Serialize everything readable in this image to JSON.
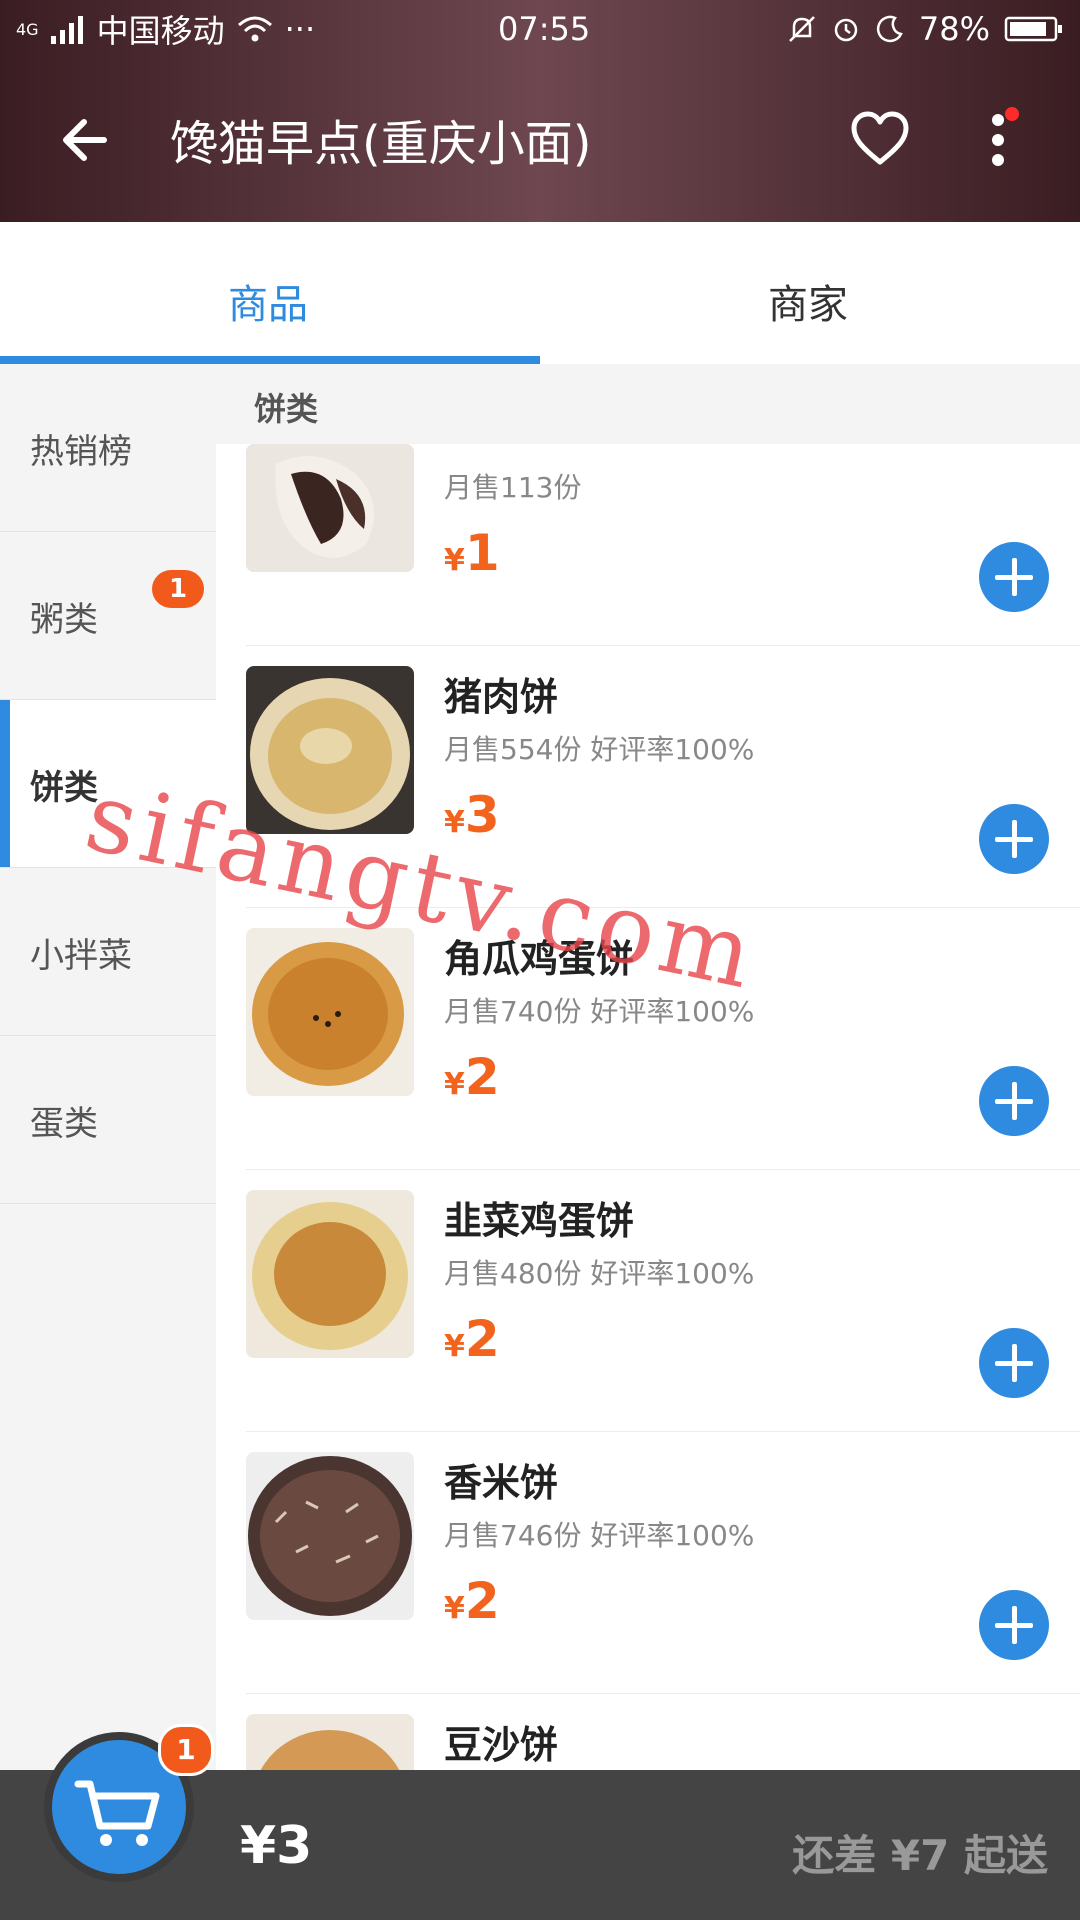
{
  "status_bar": {
    "signal": "4G",
    "carrier": "中国移动",
    "dots": "···",
    "time": "07:55",
    "battery": "78%"
  },
  "header": {
    "title": "馋猫早点(重庆小面)"
  },
  "tabs": [
    {
      "label": "商品",
      "active": true
    },
    {
      "label": "商家",
      "active": false
    }
  ],
  "sidebar": {
    "items": [
      {
        "label": "热销榜"
      },
      {
        "label": "粥类",
        "badge": "1"
      },
      {
        "label": "饼类",
        "active": true
      },
      {
        "label": "小拌菜"
      },
      {
        "label": "蛋类"
      }
    ]
  },
  "section": {
    "title": "饼类"
  },
  "items": [
    {
      "name": "",
      "stats": "月售113份",
      "price_symbol": "¥",
      "price": "1"
    },
    {
      "name": "猪肉饼",
      "stats": "月售554份   好评率100%",
      "price_symbol": "¥",
      "price": "3"
    },
    {
      "name": "角瓜鸡蛋饼",
      "stats": "月售740份   好评率100%",
      "price_symbol": "¥",
      "price": "2"
    },
    {
      "name": "韭菜鸡蛋饼",
      "stats": "月售480份   好评率100%",
      "price_symbol": "¥",
      "price": "2"
    },
    {
      "name": "香米饼",
      "stats": "月售746份   好评率100%",
      "price_symbol": "¥",
      "price": "2"
    },
    {
      "name": "豆沙饼",
      "stats": "",
      "price_symbol": "",
      "price": ""
    }
  ],
  "cart": {
    "badge": "1",
    "total": "¥3",
    "min_message": "还差 ¥7 起送"
  },
  "watermark": "sifangtv.com",
  "colors": {
    "accent": "#2f8be0",
    "price": "#f2641e",
    "badge": "#f25a1c",
    "header": "#5a3640",
    "cart_bar": "#444444",
    "watermark": "#e8464b"
  }
}
